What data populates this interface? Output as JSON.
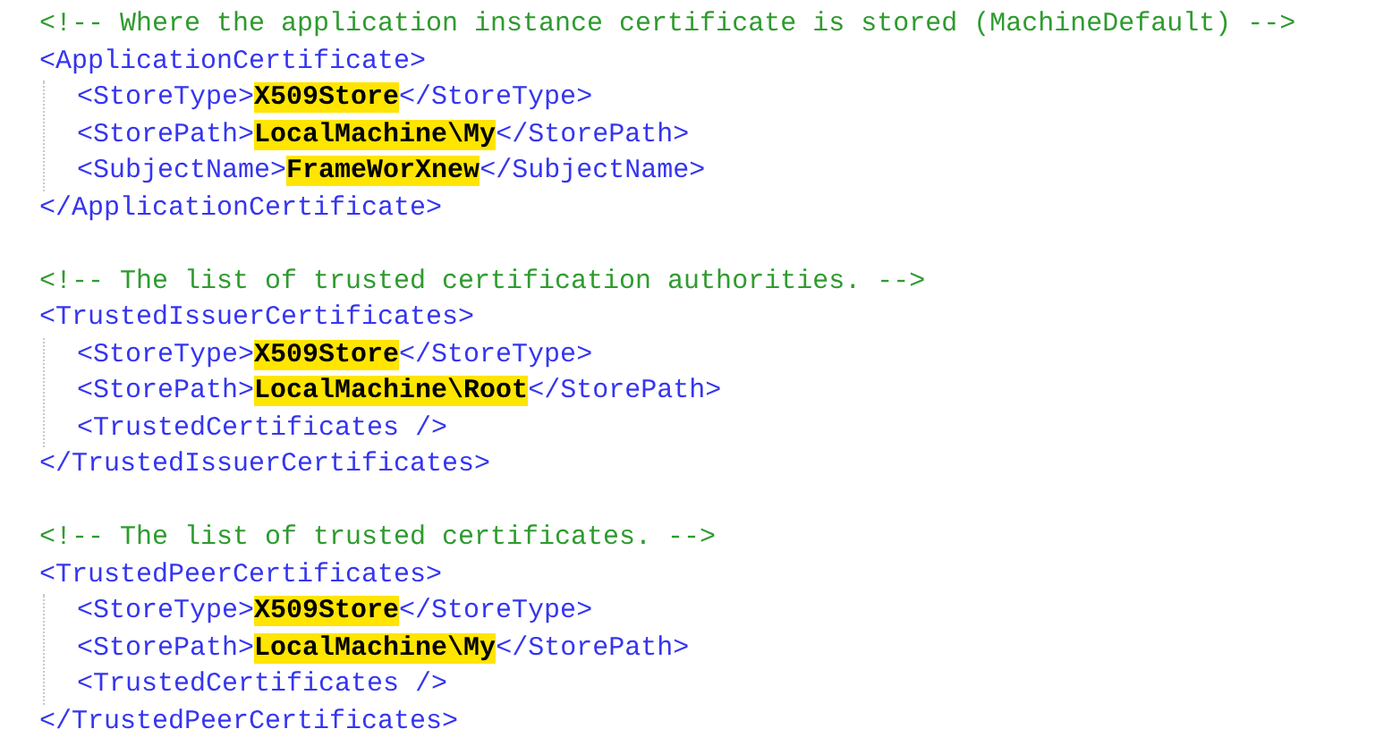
{
  "blocks": [
    {
      "comment": "<!-- Where the application instance certificate is stored (MachineDefault) -->",
      "open_tag": "<ApplicationCertificate>",
      "children": [
        {
          "kind": "element",
          "open": "<StoreType>",
          "value": "X509Store",
          "close": "</StoreType>",
          "highlighted": true
        },
        {
          "kind": "element",
          "open": "<StorePath>",
          "value": "LocalMachine\\My",
          "close": "</StorePath>",
          "highlighted": true
        },
        {
          "kind": "element",
          "open": "<SubjectName>",
          "value": "FrameWorXnew",
          "close": "</SubjectName>",
          "highlighted": true
        }
      ],
      "close_tag": "</ApplicationCertificate>"
    },
    {
      "comment": "<!-- The list of trusted certification authorities. -->",
      "open_tag": "<TrustedIssuerCertificates>",
      "children": [
        {
          "kind": "element",
          "open": "<StoreType>",
          "value": "X509Store",
          "close": "</StoreType>",
          "highlighted": true
        },
        {
          "kind": "element",
          "open": "<StorePath>",
          "value": "LocalMachine\\Root",
          "close": "</StorePath>",
          "highlighted": true
        },
        {
          "kind": "empty",
          "tag": "<TrustedCertificates />"
        }
      ],
      "close_tag": "</TrustedIssuerCertificates>"
    },
    {
      "comment": "<!-- The list of trusted certificates. -->",
      "open_tag": "<TrustedPeerCertificates>",
      "children": [
        {
          "kind": "element",
          "open": "<StoreType>",
          "value": "X509Store",
          "close": "</StoreType>",
          "highlighted": true
        },
        {
          "kind": "element",
          "open": "<StorePath>",
          "value": "LocalMachine\\My",
          "close": "</StorePath>",
          "highlighted": true
        },
        {
          "kind": "empty",
          "tag": "<TrustedCertificates />"
        }
      ],
      "close_tag": "</TrustedPeerCertificates>"
    }
  ]
}
